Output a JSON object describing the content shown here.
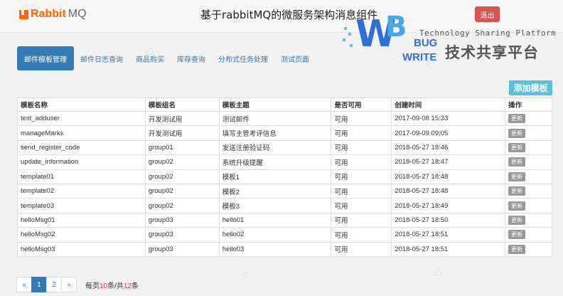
{
  "header": {
    "logo_rabbit": "Rabbit",
    "logo_mq": "MQ",
    "title": "基于rabbitMQ的微服务架构消息组件",
    "logout_label": "退出"
  },
  "watermark": {
    "w": "W",
    "b": "B",
    "bug": "BUG",
    "write": "WRITE",
    "tagline": "Technology Sharing Platform",
    "cn": "技术共享平台"
  },
  "nav": {
    "items": [
      {
        "label": "邮件模板管理",
        "active": true
      },
      {
        "label": "邮件日志查询"
      },
      {
        "label": "商品购买"
      },
      {
        "label": "库存查询"
      },
      {
        "label": "分布式任务处理"
      },
      {
        "label": "测试页面"
      }
    ]
  },
  "toolbar": {
    "add_label": "添加模板"
  },
  "table": {
    "headers": [
      "模板名称",
      "模板组名",
      "模板主题",
      "是否可用",
      "创建时间",
      "操作"
    ],
    "action_label": "更新",
    "rows": [
      [
        "test_adduser",
        "开发测试用",
        "测试邮件",
        "可用",
        "2017-09-08 15:33"
      ],
      [
        "manageMarks",
        "开发测试用",
        "填写主管考评信息",
        "可用",
        "2017-09-09 09:05"
      ],
      [
        "send_register_code",
        "group01",
        "发送注册验证码",
        "可用",
        "2018-05-27 18:46"
      ],
      [
        "update_information",
        "group02",
        "系统升级提醒",
        "可用",
        "2018-05-27 18:47"
      ],
      [
        "template01",
        "group02",
        "模板1",
        "可用",
        "2018-05-27 18:48"
      ],
      [
        "template02",
        "group02",
        "模板2",
        "可用",
        "2018-05-27 18:48"
      ],
      [
        "template03",
        "group02",
        "模板3",
        "可用",
        "2018-05-27 18:49"
      ],
      [
        "helloMsg01",
        "group03",
        "hello01",
        "可用",
        "2018-05-27 18:50"
      ],
      [
        "helloMsg02",
        "group03",
        "hello02",
        "可用",
        "2018-05-27 18:51"
      ],
      [
        "helloMsg03",
        "group03",
        "hello03",
        "可用",
        "2018-05-27 18:51"
      ]
    ]
  },
  "pagination": {
    "prev": "«",
    "pages": [
      "1",
      "2"
    ],
    "current": "1",
    "next": "»",
    "info_prefix": "每页",
    "per_page": "10",
    "info_mid": "条/共",
    "total": "12",
    "info_suffix": "条"
  }
}
